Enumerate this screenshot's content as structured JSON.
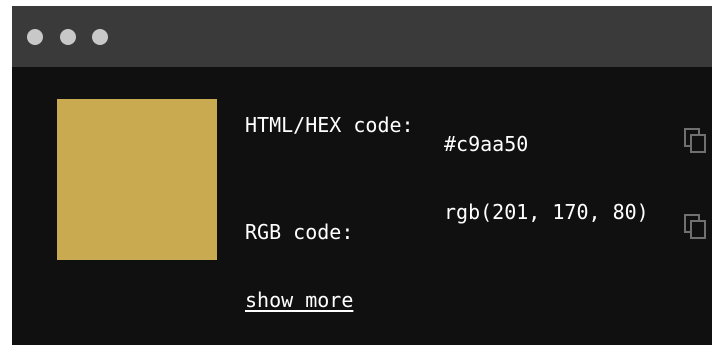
{
  "window": {
    "controls": [
      "window-dot-1",
      "window-dot-2",
      "window-dot-3"
    ]
  },
  "color": {
    "swatch_hex": "#c9aa50",
    "hex_label": "HTML/HEX code:",
    "hex_value": "#c9aa50",
    "rgb_label": "RGB code:",
    "rgb_value": "rgb(201, 170, 80)",
    "show_more_label": "show more"
  },
  "icons": {
    "copy_hex": "copy-icon",
    "copy_rgb": "copy-icon"
  },
  "colors": {
    "window_bg": "#101010",
    "titlebar_bg": "#3a3a3a",
    "dot": "#c8c8c8",
    "text": "#ffffff"
  }
}
